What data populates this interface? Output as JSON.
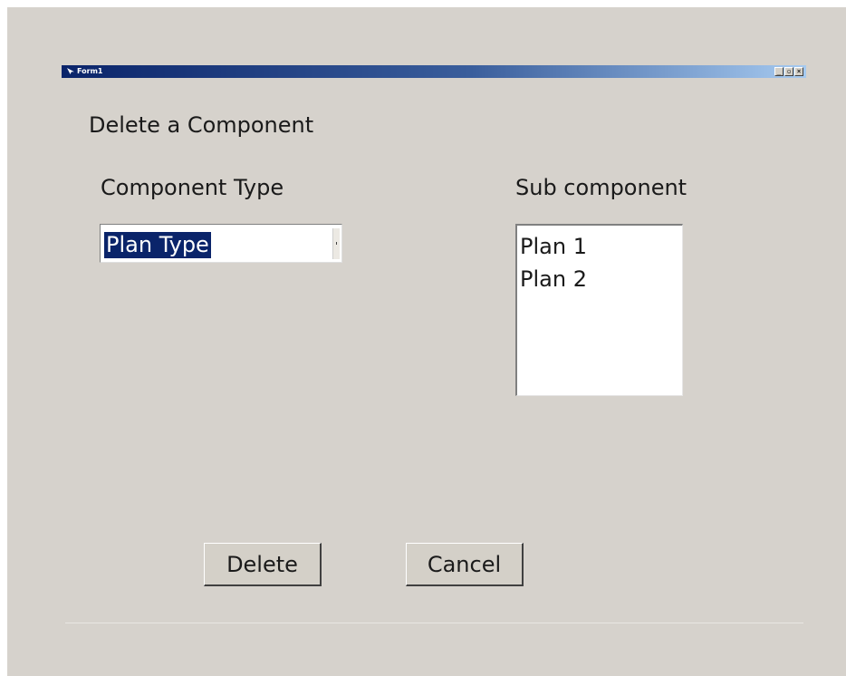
{
  "window": {
    "title": "Form1",
    "controls": {
      "minimize": "_",
      "maximize": "▫",
      "close": "×"
    }
  },
  "form": {
    "heading": "Delete a Component",
    "component_type_label": "Component Type",
    "sub_component_label": "Sub component",
    "component_type_selected": "Plan Type",
    "sub_components": [
      "Plan 1",
      "Plan 2"
    ]
  },
  "buttons": {
    "delete": "Delete",
    "cancel": "Cancel"
  },
  "colors": {
    "face": "#d6d2cc",
    "titlebar_start": "#0a246a",
    "titlebar_end": "#a6caf0",
    "selection": "#0a246a"
  }
}
